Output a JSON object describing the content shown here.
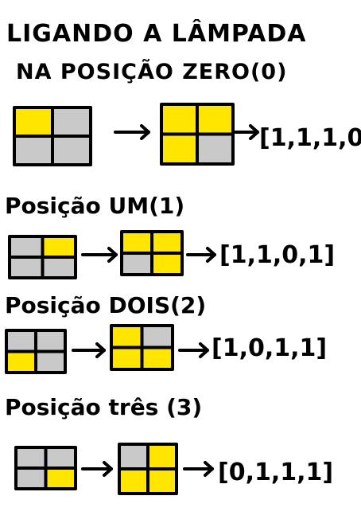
{
  "title": {
    "line1": "LIGANDO A LÂMPADA",
    "line2": "NA POSIÇÃO ZERO(0)"
  },
  "colors": {
    "on": "#ffe600",
    "off": "#c9c9c9",
    "ink": "#000000"
  },
  "rows": [
    {
      "heading": "",
      "before": [
        1,
        0,
        0,
        0
      ],
      "after": [
        1,
        1,
        1,
        0
      ],
      "result": "[1,1,1,0]"
    },
    {
      "heading": "Posição UM(1)",
      "before": [
        0,
        1,
        0,
        0
      ],
      "after": [
        1,
        1,
        0,
        1
      ],
      "result": "[1,1,0,1]"
    },
    {
      "heading": "Posição DOIS(2)",
      "before": [
        0,
        0,
        1,
        0
      ],
      "after": [
        1,
        0,
        1,
        1
      ],
      "result": "[1,0,1,1]"
    },
    {
      "heading": "Posição três (3)",
      "before": [
        0,
        0,
        0,
        1
      ],
      "after": [
        0,
        1,
        1,
        1
      ],
      "result": "[0,1,1,1]"
    }
  ]
}
